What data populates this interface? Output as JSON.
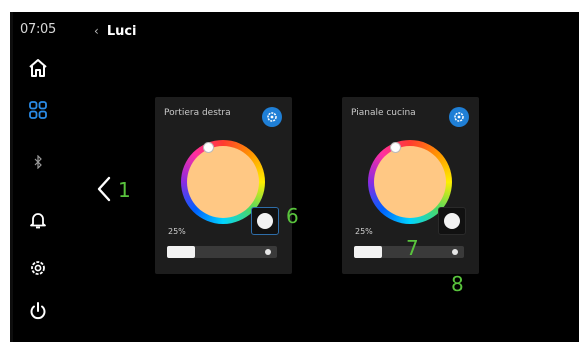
{
  "status": {
    "time": "07:05"
  },
  "header": {
    "back_icon": "chevron-left-icon",
    "title": "Luci"
  },
  "sidebar": {
    "items": [
      {
        "name": "home",
        "icon": "home-icon"
      },
      {
        "name": "apps",
        "icon": "grid-icon",
        "active": true
      },
      {
        "name": "bluetooth",
        "icon": "bluetooth-icon"
      },
      {
        "name": "notifications",
        "icon": "bell-icon"
      },
      {
        "name": "settings",
        "icon": "gear-icon"
      },
      {
        "name": "power",
        "icon": "power-icon"
      }
    ]
  },
  "cards": [
    {
      "title": "Portiera destra",
      "brightness_text": "25%",
      "brightness_level": 0.25
    },
    {
      "title": "Pianale cucina",
      "brightness_text": "25%",
      "brightness_level": 0.25
    }
  ],
  "annotations": [
    "1",
    "6",
    "7",
    "8"
  ],
  "colors": {
    "background": "#000000",
    "card": "#1d1d1d",
    "accent": "#1f7fd6",
    "selected_color": "#ffc884",
    "annotation": "#59c43d"
  }
}
